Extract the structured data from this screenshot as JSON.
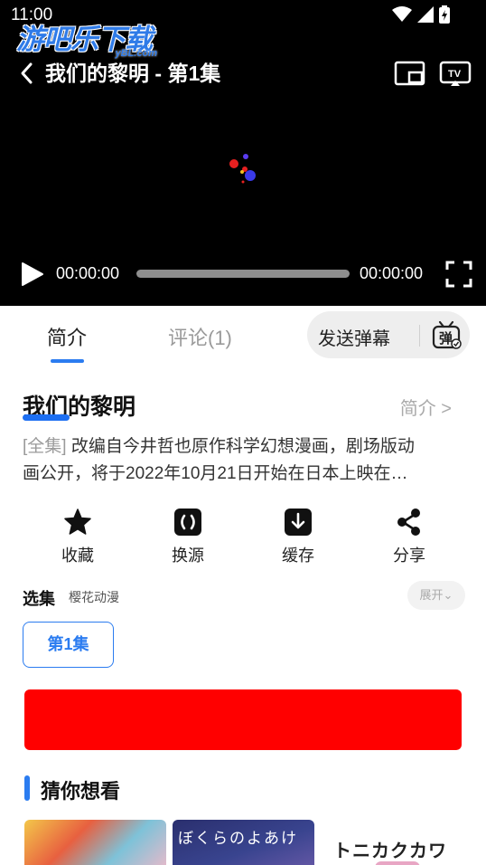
{
  "status_bar": {
    "time": "11:00"
  },
  "watermark": {
    "main": "游吧乐下载",
    "sub": "yBL.com"
  },
  "player": {
    "title": "我们的黎明 - 第1集",
    "current_time": "00:00:00",
    "total_time": "00:00:00",
    "progress": 0
  },
  "tabs": [
    {
      "label": "简介",
      "active": true
    },
    {
      "label": "评论(1)",
      "active": false
    }
  ],
  "danmaku": {
    "label": "发送弹幕",
    "icon_text": "弹"
  },
  "show": {
    "title": "我们的黎明",
    "intro_link": "简介 >",
    "tag": "[全集]",
    "desc_line1": " 改编自今井哲也原作科学幻想漫画，剧场版动",
    "desc_line2": "画公开，将于2022年10月21日开始在日本上映在…"
  },
  "actions": [
    {
      "label": "收藏",
      "icon": "star-icon"
    },
    {
      "label": "换源",
      "icon": "switch-source-icon"
    },
    {
      "label": "缓存",
      "icon": "download-icon"
    },
    {
      "label": "分享",
      "icon": "share-icon"
    }
  ],
  "episodes": {
    "label": "选集",
    "source": "樱花动漫",
    "expand": "展开",
    "items": [
      "第1集"
    ]
  },
  "recommend": {
    "title": "猜你想看",
    "card2_text": "ぼくらのよあけ",
    "card3_text": "トニカクカワイイ"
  },
  "colors": {
    "accent": "#2b7cf0",
    "banner": "#ff0000",
    "player_bg": "#000000"
  }
}
